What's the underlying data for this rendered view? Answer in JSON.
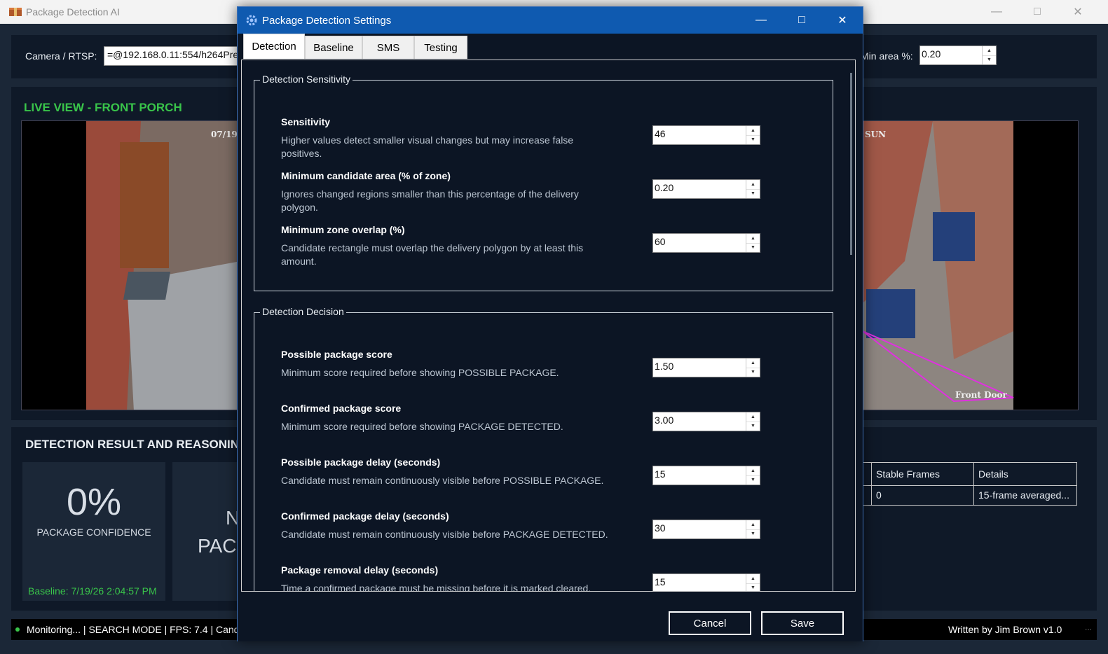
{
  "app": {
    "title": "Package Detection AI",
    "icon": "package-icon"
  },
  "toolbar": {
    "camera_label": "Camera / RTSP:",
    "camera_value": "=@192.168.0.11:554/h264Prev",
    "min_area_label": "Min area %:",
    "min_area_value": "0.20"
  },
  "live": {
    "title": "LIVE VIEW - FRONT PORCH",
    "timestamp_overlay": "07/19",
    "sun_overlay": "SUN",
    "door_label": "Front Door"
  },
  "result": {
    "title": "DETECTION RESULT AND REASONING",
    "confidence": "0%",
    "confidence_label": "PACKAGE CONFIDENCE",
    "baseline": "Baseline: 7/19/26 2:04:57 PM",
    "status_partial_1": "N",
    "status_partial_2": "PAC"
  },
  "table": {
    "headers": [
      "Stable Frames",
      "Details"
    ],
    "rows": [
      [
        "0",
        "15-frame averaged..."
      ]
    ]
  },
  "status": {
    "text": "Monitoring... | SEARCH MODE | FPS: 7.4 | Cand",
    "credit": "Written by Jim Brown   v1.0"
  },
  "dialog": {
    "title": "Package Detection Settings",
    "tabs": [
      "Detection",
      "Baseline",
      "SMS",
      "Testing"
    ],
    "active_tab": "Detection",
    "groups": [
      {
        "title": "Detection Sensitivity",
        "settings": [
          {
            "name": "Sensitivity",
            "desc": "Higher values detect smaller visual changes but may increase false positives.",
            "value": "46"
          },
          {
            "name": "Minimum candidate area (% of zone)",
            "desc": "Ignores changed regions smaller than this percentage of the delivery polygon.",
            "value": "0.20"
          },
          {
            "name": "Minimum zone overlap (%)",
            "desc": "Candidate rectangle must overlap the delivery polygon by at least this amount.",
            "value": "60"
          }
        ]
      },
      {
        "title": "Detection Decision",
        "settings": [
          {
            "name": "Possible package score",
            "desc": "Minimum score required before showing POSSIBLE PACKAGE.",
            "value": "1.50"
          },
          {
            "name": "Confirmed package score",
            "desc": "Minimum score required before showing PACKAGE DETECTED.",
            "value": "3.00"
          },
          {
            "name": "Possible package delay (seconds)",
            "desc": "Candidate must remain continuously visible before POSSIBLE PACKAGE.",
            "value": "15"
          },
          {
            "name": "Confirmed package delay (seconds)",
            "desc": "Candidate must remain continuously visible before PACKAGE DETECTED.",
            "value": "30"
          },
          {
            "name": "Package removal delay (seconds)",
            "desc": "Time a confirmed package must be missing before it is marked cleared.",
            "value": "15"
          }
        ]
      }
    ],
    "cancel_label": "Cancel",
    "save_label": "Save"
  },
  "colors": {
    "accent_green": "#39c44a",
    "dialog_titlebar": "#0f5ab0",
    "panel": "#0f1928"
  }
}
